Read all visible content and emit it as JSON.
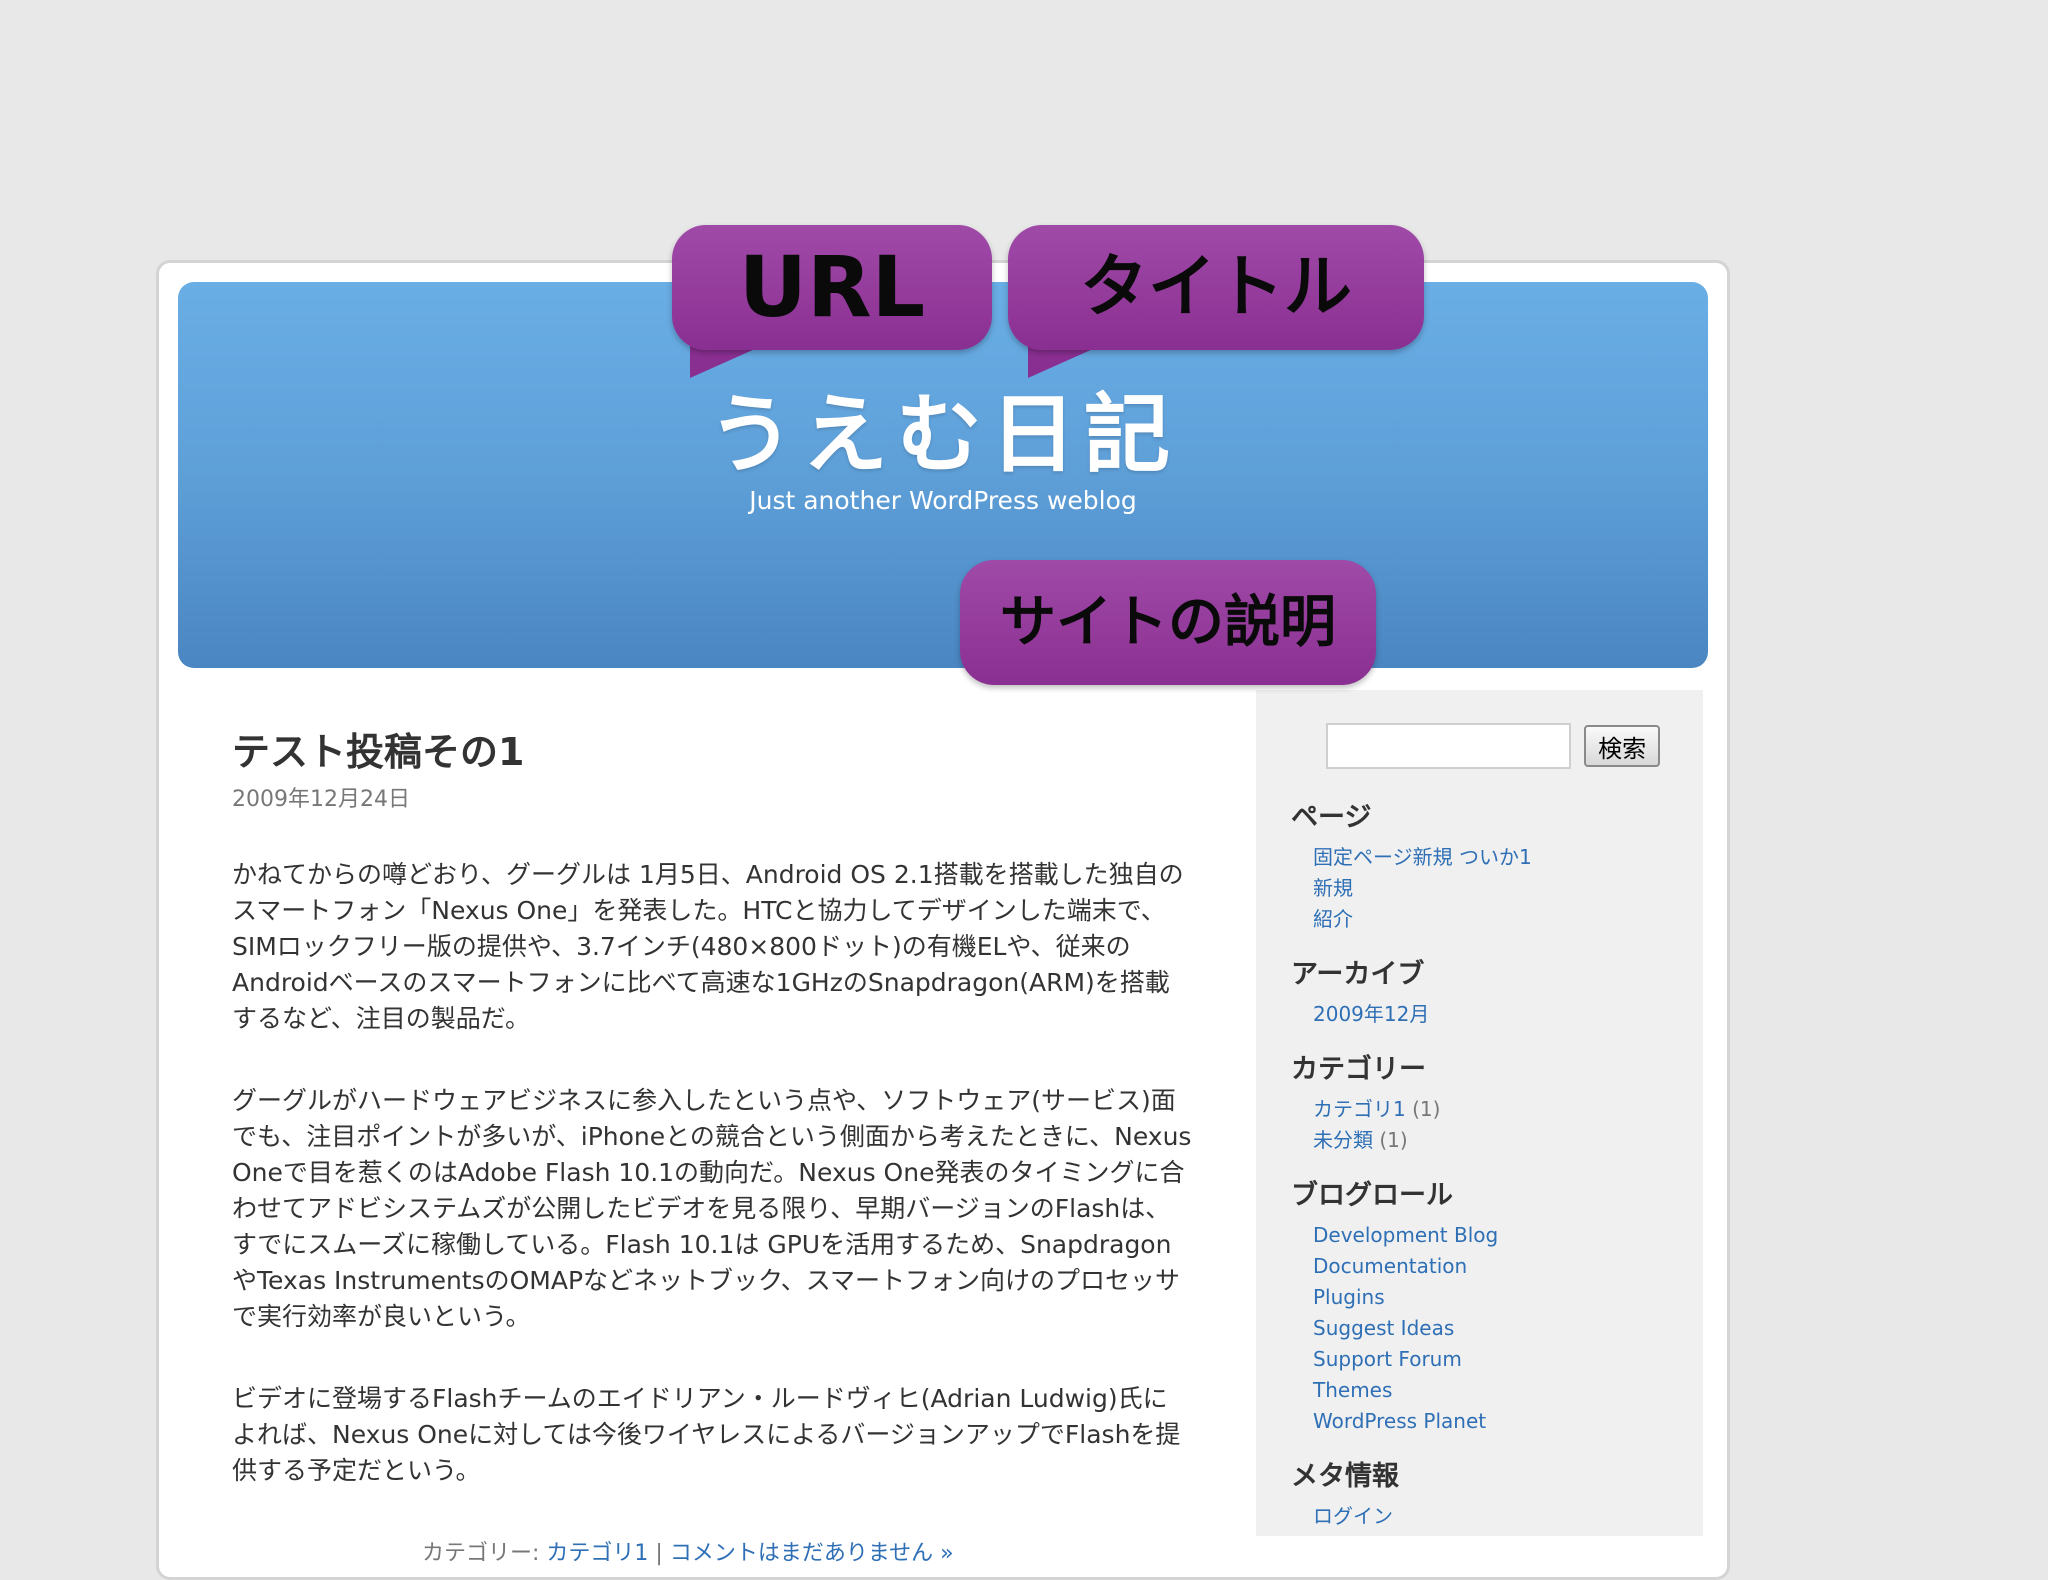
{
  "header": {
    "site_title": "うえむ日記",
    "site_description": "Just another WordPress weblog"
  },
  "annotations": {
    "url": "URL",
    "title": "タイトル",
    "description": "サイトの説明"
  },
  "post": {
    "title": "テスト投稿その1",
    "date": "2009年12月24日",
    "paragraphs": [
      "かねてからの噂どおり、グーグルは 1月5日、Android OS 2.1搭載を搭載した独自のスマートフォン「Nexus One」を発表した。HTCと協力してデザインした端末で、SIMロックフリー版の提供や、3.7インチ(480×800ドット)の有機ELや、従来の Androidベースのスマートフォンに比べて高速な1GHzのSnapdragon(ARM)を搭載するなど、注目の製品だ。",
      "グーグルがハードウェアビジネスに参入したという点や、ソフトウェア(サービス)面でも、注目ポイントが多いが、iPhoneとの競合という側面から考えたときに、Nexus Oneで目を惹くのはAdobe Flash 10.1の動向だ。Nexus One発表のタイミングに合わせてアドビシステムズが公開したビデオを見る限り、早期バージョンのFlashは、すでにスムーズに稼働している。Flash 10.1は GPUを活用するため、SnapdragonやTexas InstrumentsのOMAPなどネットブック、スマートフォン向けのプロセッサで実行効率が良いという。",
      "ビデオに登場するFlashチームのエイドリアン・ルードヴィヒ(Adrian Ludwig)氏によれば、Nexus Oneに対しては今後ワイヤレスによるバージョンアップでFlashを提供する予定だという。"
    ],
    "footer_prefix": "カテゴリー: ",
    "footer_category": "カテゴリ1",
    "footer_separator": " | ",
    "footer_comments": "コメントはまだありません »"
  },
  "sidebar": {
    "search_button": "検索",
    "search_placeholder": "",
    "pages_heading": "ページ",
    "pages": [
      "固定ページ新規 ついか1",
      "新規",
      "紹介"
    ],
    "archives_heading": "アーカイブ",
    "archives": [
      "2009年12月"
    ],
    "categories_heading": "カテゴリー",
    "categories": [
      {
        "label": "カテゴリ1",
        "count": "(1)"
      },
      {
        "label": "未分類",
        "count": "(1)"
      }
    ],
    "blogroll_heading": "ブログロール",
    "blogroll": [
      "Development Blog",
      "Documentation",
      "Plugins",
      "Suggest Ideas",
      "Support Forum",
      "Themes",
      "WordPress Planet"
    ],
    "meta_heading": "メタ情報",
    "meta": [
      "ログイン"
    ]
  },
  "colors": {
    "header_blue": "#5e9fd8",
    "bubble_purple": "#8a2f92",
    "link_blue": "#2e6fb5"
  }
}
